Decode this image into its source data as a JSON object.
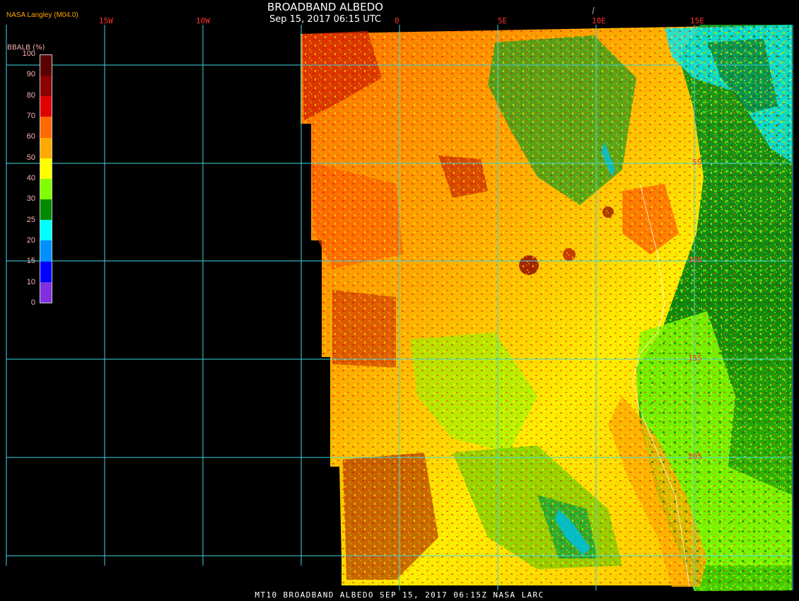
{
  "header": {
    "credit": "NASA Langley (M04.0)",
    "title": "BROADBAND ALBEDO",
    "subtitle": "Sep 15, 2017 06:15 UTC"
  },
  "legend": {
    "title": "BBALB (%)",
    "ticks": [
      "100",
      "90",
      "80",
      "70",
      "60",
      "50",
      "40",
      "30",
      "25",
      "20",
      "15",
      "10",
      "0"
    ],
    "colors": [
      "#5a0000",
      "#8b0000",
      "#e00000",
      "#ff6a00",
      "#ffaa00",
      "#ffff00",
      "#80ff00",
      "#008a00",
      "#00ffff",
      "#0090ff",
      "#0000ff",
      "#8030e0"
    ]
  },
  "grid": {
    "longitudes": [
      "15W",
      "10W",
      "0",
      "5E",
      "10E",
      "15E"
    ],
    "latitudes": [
      "5S",
      "10S",
      "15S",
      "20S"
    ]
  },
  "footer": {
    "caption": "MT10  BROADBAND ALBEDO   SEP 15, 2017 06:15Z   NASA LARC"
  }
}
